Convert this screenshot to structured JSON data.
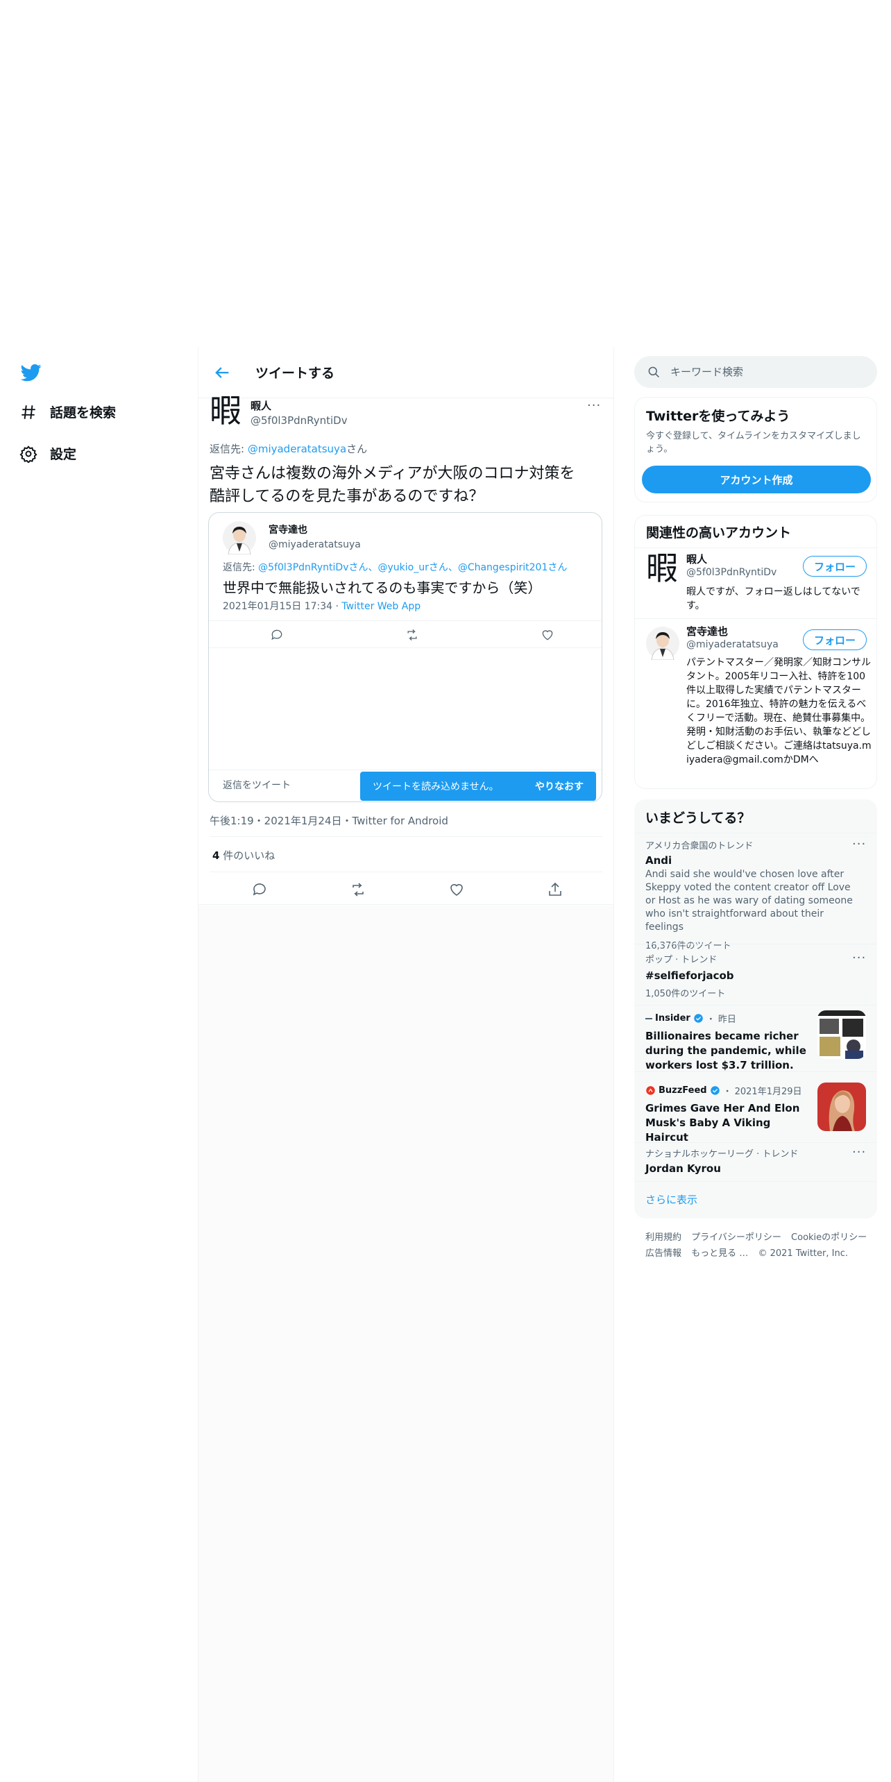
{
  "nav": {
    "explore": "話題を検索",
    "settings": "設定"
  },
  "header": {
    "title": "ツイートする"
  },
  "tweet": {
    "avatar_char": "暇",
    "name": "暇人",
    "handle": "@5f0l3PdnRyntiDv",
    "reply_label": "返信先: ",
    "reply_mention": "@miyaderatatsuya",
    "reply_suffix": "さん",
    "text_line1": "宮寺さんは複数の海外メディアが大阪のコロナ対策を",
    "text_line2": "酷評してるのを見た事があるのですね？",
    "meta": "午後1:19・2021年1月24日・Twitter for Android",
    "likes_count": "4",
    "likes_label": " 件のいいね"
  },
  "quote": {
    "name": "宮寺達也",
    "handle": "@miyaderatatsuya",
    "reply_label": "返信先: ",
    "reply_mentions": "@5f0l3PdnRyntiDvさん、@yukio_urさん、@Changespirit201さん",
    "text": "世界中で無能扱いされてるのも事実ですから（笑）",
    "date": "2021年01月15日 17:34 · ",
    "app": "Twitter Web App",
    "reply_tweet": "返信をツイート",
    "toast_text": "ツイートを読み込めません。",
    "toast_retry": "やりなおす"
  },
  "search": {
    "placeholder": "キーワード検索"
  },
  "signup_card": {
    "title": "Twitterを使ってみよう",
    "desc": "今すぐ登録して、タイムラインをカスタマイズしましょう。",
    "button": "アカウント作成"
  },
  "related": {
    "title": "関連性の高いアカウント",
    "accounts": [
      {
        "avatar_char": "暇",
        "name": "暇人",
        "handle": "@5f0l3PdnRyntiDv",
        "bio": "暇人ですが、フォロー返しはしてないです。",
        "follow": "フォロー"
      },
      {
        "name": "宮寺達也",
        "handle": "@miyaderatatsuya",
        "bio": "パテントマスター／発明家／知財コンサルタント。2005年リコー入社、特許を100件以上取得した実績でパテントマスターに。2016年独立、特許の魅力を伝えるべくフリーで活動。現在、絶賛仕事募集中。発明・知財活動のお手伝い、執筆などどしどしご相談ください。ご連絡はtatsuya.miyadera@gmail.comかDMへ",
        "follow": "フォロー"
      }
    ]
  },
  "trends": {
    "title": "いまどうしてる？",
    "items": [
      {
        "context": "アメリカ合衆国のトレンド",
        "title": "Andi",
        "sub": "Andi said she would've chosen love after Skeppy voted the content creator off Love or Host as he was wary of dating someone who isn't straightforward about their feelings",
        "count": "16,376件のツイート"
      },
      {
        "context": "ポップ · トレンド",
        "title": "#selfieforjacob",
        "count": "1,050件のツイート"
      },
      {
        "source": "Insider",
        "time": "昨日",
        "title": "Billionaires became richer during the pandemic, while workers lost $3.7 trillion."
      },
      {
        "source": "BuzzFeed",
        "time": "2021年1月29日",
        "title": "Grimes Gave Her And Elon Musk's Baby A Viking Haircut"
      },
      {
        "context": "ナショナルホッケーリーグ · トレンド",
        "title": "Jordan Kyrou"
      }
    ],
    "show_more": "さらに表示"
  },
  "footer": {
    "line1": [
      "利用規約",
      "プライバシーポリシー",
      "Cookieのポリシー"
    ],
    "line2": [
      "広告情報",
      "もっと見る …",
      "© 2021 Twitter, Inc."
    ]
  },
  "colors": {
    "accent": "#1d9bf0",
    "text": "#0f1419",
    "muted": "#536471",
    "border": "#eff3f4"
  }
}
